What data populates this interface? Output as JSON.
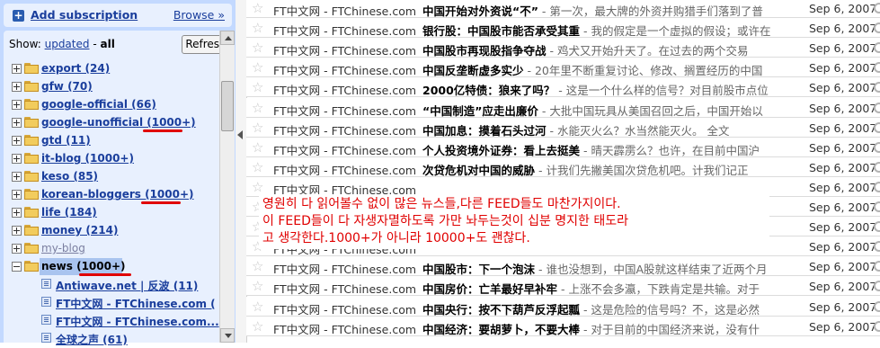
{
  "sidebar": {
    "add_subscription": "Add subscription",
    "browse": "Browse »",
    "show_label": "Show:",
    "show_updated": "updated",
    "show_sep": "-",
    "show_all": "all",
    "refresh": "Refresh",
    "folders": [
      {
        "label": "export (24)",
        "expander": "plus"
      },
      {
        "label": "gfw (70)",
        "expander": "plus"
      },
      {
        "label": "google-official (66)",
        "expander": "plus"
      },
      {
        "label": "google-unofficial (1000+)",
        "expander": "plus",
        "underlined_red": true
      },
      {
        "label": "gtd (11)",
        "expander": "plus"
      },
      {
        "label": "it-blog (1000+)",
        "expander": "plus"
      },
      {
        "label": "keso (85)",
        "expander": "plus"
      },
      {
        "label": "korean-bloggers (1000+)",
        "expander": "plus",
        "underlined_red": true
      },
      {
        "label": "life (184)",
        "expander": "plus"
      },
      {
        "label": "money (214)",
        "expander": "plus"
      },
      {
        "label": "my-blog",
        "expander": "plus",
        "muted": true
      },
      {
        "label": "news (1000+)",
        "expander": "minus",
        "selected": true,
        "underlined_red": true
      }
    ],
    "feeds": [
      {
        "label": "Antiwave.net | 反波 (11)"
      },
      {
        "label": "FT中文网 - FTChinese.com ("
      },
      {
        "label": "FT中文网 - FTChinese.com..."
      },
      {
        "label": "全球之声 (61)"
      }
    ]
  },
  "entries": [
    {
      "source": "FT中文网 - FTChinese.com",
      "title": "中国开始对外资说“不”",
      "snippet": " - 第一次，最大牌的外资并购猎手们落到了普",
      "date": "Sep 6, 2007"
    },
    {
      "source": "FT中文网 - FTChinese.com",
      "title": "银行股：中国股市能否承受其重",
      "snippet": " - 我的假定是一个虚拟的假设；或许在",
      "date": "Sep 6, 2007"
    },
    {
      "source": "FT中文网 - FTChinese.com",
      "title": "中国股市再现股指争夺战",
      "snippet": " - 鸡犬又开始升天了。在过去的两个交易",
      "date": "Sep 6, 2007"
    },
    {
      "source": "FT中文网 - FTChinese.com",
      "title": "中国反垄断虚多实少",
      "snippet": " - 20年里不断重复讨论、修改、搁置经历的中国",
      "date": "Sep 6, 2007"
    },
    {
      "source": "FT中文网 - FTChinese.com",
      "title": "2000亿特债：狼来了吗？",
      "snippet": " - 这是一个什么样的信号？对目前股市点位",
      "date": "Sep 6, 2007"
    },
    {
      "source": "FT中文网 - FTChinese.com",
      "title": "“中国制造”应走出廉价",
      "snippet": " - 大批中国玩具从美国召回之后，中国开始以",
      "date": "Sep 6, 2007"
    },
    {
      "source": "FT中文网 - FTChinese.com",
      "title": "中国加息：摸着石头过河",
      "snippet": " - 水能灭火么？水当然能灭火。 全文",
      "date": "Sep 6, 2007"
    },
    {
      "source": "FT中文网 - FTChinese.com",
      "title": "个人投资境外证券：看上去挺美",
      "snippet": " - 晴天霹雳么？也许，在目前中国沪",
      "date": "Sep 6, 2007"
    },
    {
      "source": "FT中文网 - FTChinese.com",
      "title": "次贷危机对中国的威胁",
      "snippet": " - 计我们先撇美国次贷危机吧。计我们记正",
      "date": "Sep 6, 2007"
    },
    {
      "source": "FT中文网 - FTChinese.com",
      "title": "",
      "snippet": "",
      "date": "Sep 6, 2007"
    },
    {
      "source": "FT中文网 - FTChinese.com",
      "title": "",
      "snippet": "",
      "date": "Sep 6, 2007"
    },
    {
      "source": "FT中文网 - FTChinese.com",
      "title": "",
      "snippet": "",
      "date": "Sep 6, 2007"
    },
    {
      "source": "FT中文网 - FTChinese.com",
      "title": "",
      "snippet": "",
      "date": "Sep 6, 2007"
    },
    {
      "source": "FT中文网 - FTChinese.com",
      "title": "中国股市：下一个泡沫",
      "snippet": " - 谁也没想到，中国A股就这样结束了近两个月",
      "date": "Sep 6, 2007"
    },
    {
      "source": "FT中文网 - FTChinese.com",
      "title": "中国房价：亡羊最好早补牢",
      "snippet": " - 上涨不会多瀛，下跌肯定是共输。对于",
      "date": "Sep 6, 2007"
    },
    {
      "source": "FT中文网 - FTChinese.com",
      "title": "中国央行：按不下葫芦反浮起瓢",
      "snippet": " - 这是危险的信号吗？不，这是必然",
      "date": "Sep 6, 2007"
    },
    {
      "source": "FT中文网 - FTChinese.com",
      "title": "中国经济：要胡萝卜，不要大棒",
      "snippet": " - 对于目前的中国经济来说，没有什",
      "date": "Sep 6, 2007"
    }
  ],
  "annotation": {
    "lines": [
      "영원히 다 읽어볼수 없이 많은 뉴스들,다른 FEED들도 마찬가지이다.",
      "이 FEED들이 다 자생자멸하도록 가만 놔두는것이 십분 명지한 태도라",
      "고 생각한다.1000+가 아니라 10000+도 괜찮다."
    ]
  },
  "colors": {
    "sidebar_bg": "#c3d9ff",
    "panel_bg": "#e8f0fe",
    "link": "#1a3e9c",
    "annotation_red": "#e00000"
  }
}
